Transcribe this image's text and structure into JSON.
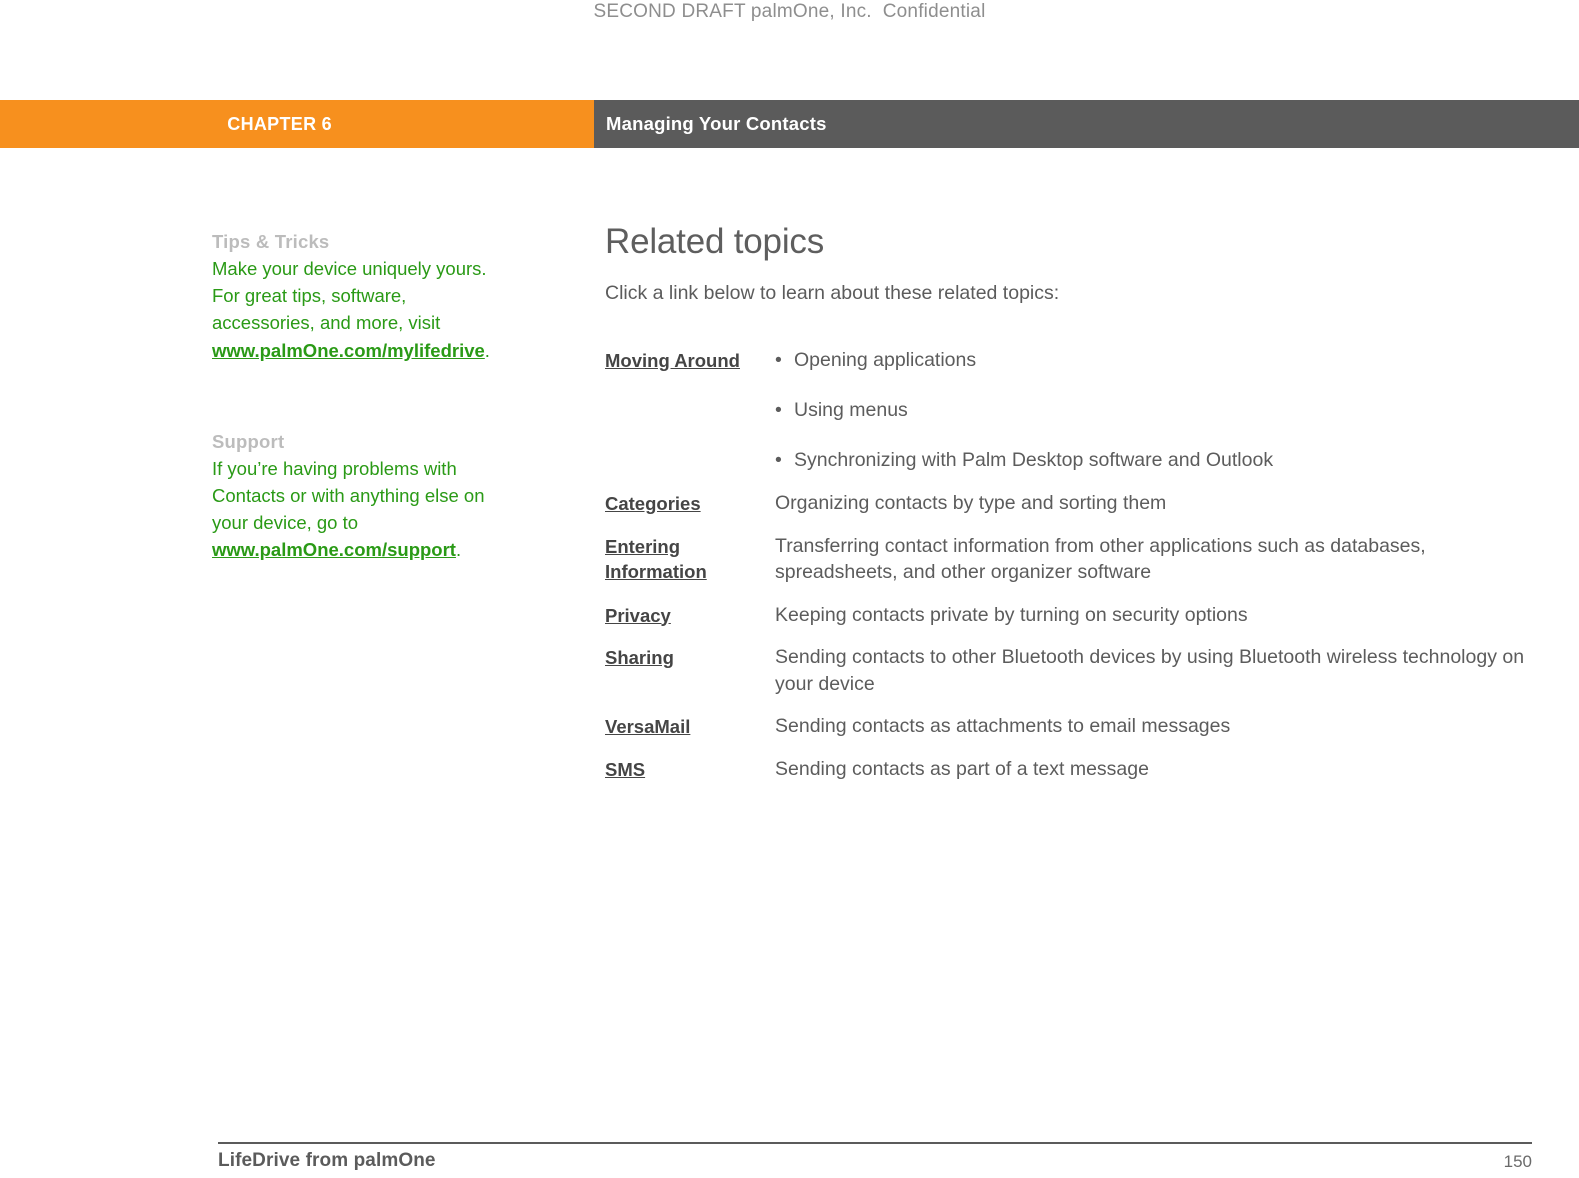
{
  "draft_header": "SECOND DRAFT palmOne, Inc.  Confidential",
  "chapter_bar": {
    "chapter_label": "CHAPTER 6",
    "chapter_title": "Managing Your Contacts",
    "orange": "#f7901e",
    "gray": "#5b5b5b"
  },
  "sidebar": {
    "accent_color": "#2a9a16",
    "heading_color": "#bcbcbc",
    "blocks": [
      {
        "heading": "Tips & Tricks",
        "text_before": "Make your device uniquely yours. For great tips, software, accessories, and more, visit ",
        "link": "www.palmOne.com/mylifedrive",
        "text_after": "."
      },
      {
        "heading": "Support",
        "text_before": "If you’re having problems with Contacts or with anything else on your device, go to ",
        "link": "www.palmOne.com/support",
        "text_after": "."
      }
    ]
  },
  "main": {
    "title": "Related topics",
    "intro": "Click a link below to learn about these related topics:",
    "topics": [
      {
        "link": "Moving Around",
        "bullets": [
          "Opening applications",
          "Using menus",
          "Synchronizing with Palm Desktop software and Outlook"
        ],
        "description": ""
      },
      {
        "link": "Categories",
        "description": "Organizing contacts by type and sorting them"
      },
      {
        "link": "Entering Information",
        "description": "Transferring contact information from other applications such as databases, spreadsheets, and other organizer software"
      },
      {
        "link": "Privacy",
        "description": "Keeping contacts private by turning on security options"
      },
      {
        "link": "Sharing",
        "description": "Sending contacts to other Bluetooth devices by using Bluetooth wireless technology on your device"
      },
      {
        "link": "VersaMail",
        "description": "Sending contacts as attachments to email messages"
      },
      {
        "link": "SMS",
        "description": "Sending contacts as part of a text message"
      }
    ],
    "bullet_glyph": "•"
  },
  "footer": {
    "product": "LifeDrive from palmOne",
    "page_number": "150"
  }
}
